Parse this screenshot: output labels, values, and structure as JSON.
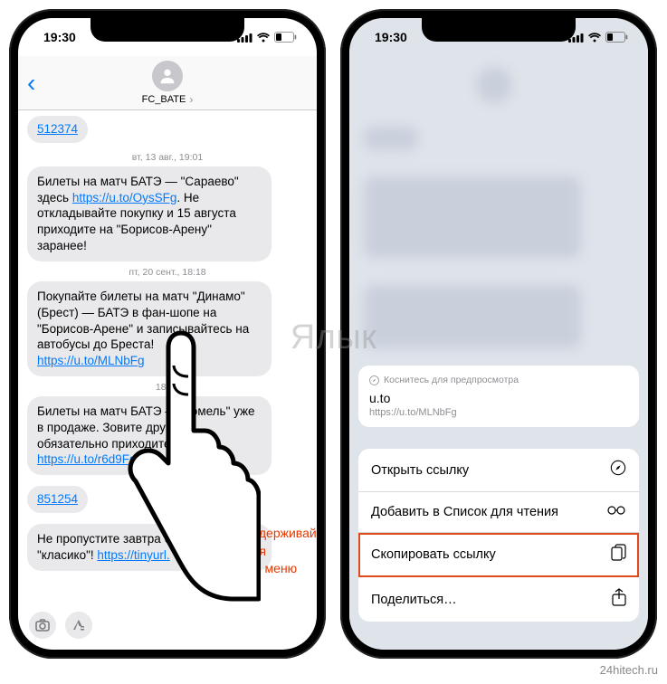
{
  "status": {
    "time": "19:30"
  },
  "left": {
    "contact": "FC_BATE",
    "m0_link": "512374",
    "ts1": "вт, 13 авг., 19:01",
    "m1_a": "Билеты на матч БАТЭ — \"Сараево\" здесь ",
    "m1_link": "https://u.to/OysSFg",
    "m1_b": ". Не откладывайте покупку и 15 августа приходите на \"Борисов-Арену\" заранее!",
    "ts2": "пт, 20 сент., 18:18",
    "m2_a": "Покупайте билеты на матч \"Динамо\" (Брест) — БАТЭ в фан-шопе на \"Борисов-Арене\" и записывайтесь на автобусы до Бреста! ",
    "m2_link_vis": "https://u.to/MLNbFg",
    "ts3": "18:01",
    "m3_a": "Билеты на матч БАТЭ — \"Гомель\" уже в продаже. Зовите друзей и обязательно приходите! ",
    "m3_link": "https://u.to/r6d9Fg",
    "m4_link": "851254",
    "m5_a": "Не пропустите завтра белорусское \"класико\"! ",
    "m5_link": "https://tinyurl."
  },
  "hint": "Нажмите и удерживайте до появления контекстного меню",
  "right": {
    "preview_hdr": "Коснитесь для предпросмотра",
    "preview_title": "u.to",
    "preview_url": "https://u.to/MLNbFg",
    "menu": {
      "open": "Открыть ссылку",
      "read": "Добавить в Список для чтения",
      "copy": "Скопировать ссылку",
      "share": "Поделиться…"
    }
  },
  "watermark": "Я",
  "watermark2": "лык",
  "credit": "24hitech.ru"
}
